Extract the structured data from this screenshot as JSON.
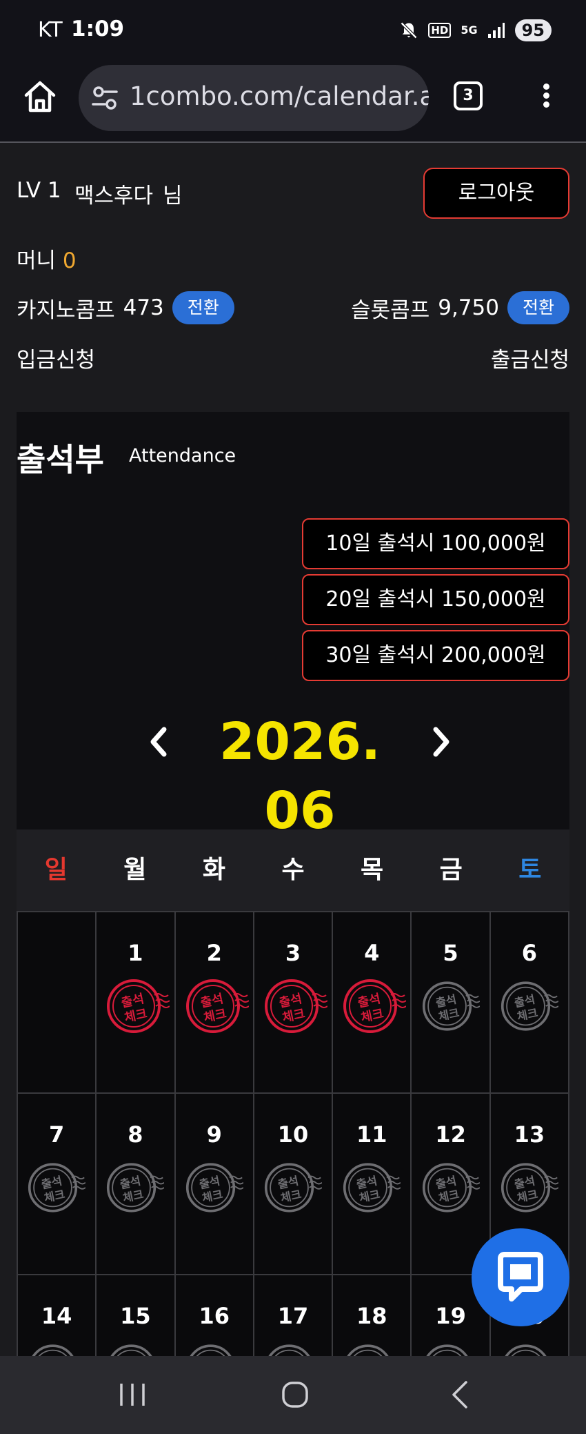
{
  "status_bar": {
    "carrier": "KT",
    "time": "1:09",
    "icons": [
      "mute-icon",
      "hd-icon",
      "5g-icon",
      "signal-icon"
    ],
    "hd_text": "HD",
    "network_text": "5G",
    "battery": "95"
  },
  "browser": {
    "url": "1combo.com/calendar.as",
    "tab_count": "3"
  },
  "account": {
    "level": "LV 1",
    "username": "맥스후다",
    "honorific": "님",
    "logout_label": "로그아웃",
    "money_label": "머니",
    "money_value": "0",
    "casino_comp_label": "카지노콤프",
    "casino_comp_value": "473",
    "slot_comp_label": "슬롯콤프",
    "slot_comp_value": "9,750",
    "convert_label": "전환",
    "deposit_label": "입금신청",
    "withdraw_label": "출금신청"
  },
  "attendance": {
    "title": "출석부",
    "subtitle": "Attendance",
    "rewards": [
      "10일 출석시 100,000원",
      "20일 출석시 150,000원",
      "30일 출석시 200,000원"
    ],
    "month": "2026. 06",
    "weekdays": [
      "일",
      "월",
      "화",
      "수",
      "목",
      "금",
      "토"
    ],
    "stamp_text_top": "출석",
    "stamp_text_bottom": "체크",
    "days": [
      {
        "day": "",
        "checked": false,
        "stamp": false
      },
      {
        "day": "1",
        "checked": true,
        "stamp": true
      },
      {
        "day": "2",
        "checked": true,
        "stamp": true
      },
      {
        "day": "3",
        "checked": true,
        "stamp": true
      },
      {
        "day": "4",
        "checked": true,
        "stamp": true
      },
      {
        "day": "5",
        "checked": false,
        "stamp": true
      },
      {
        "day": "6",
        "checked": false,
        "stamp": true
      },
      {
        "day": "7",
        "checked": false,
        "stamp": true
      },
      {
        "day": "8",
        "checked": false,
        "stamp": true
      },
      {
        "day": "9",
        "checked": false,
        "stamp": true
      },
      {
        "day": "10",
        "checked": false,
        "stamp": true
      },
      {
        "day": "11",
        "checked": false,
        "stamp": true
      },
      {
        "day": "12",
        "checked": false,
        "stamp": true
      },
      {
        "day": "13",
        "checked": false,
        "stamp": true
      },
      {
        "day": "14",
        "checked": false,
        "stamp": true
      },
      {
        "day": "15",
        "checked": false,
        "stamp": true
      },
      {
        "day": "16",
        "checked": false,
        "stamp": true
      },
      {
        "day": "17",
        "checked": false,
        "stamp": true
      },
      {
        "day": "18",
        "checked": false,
        "stamp": true
      },
      {
        "day": "19",
        "checked": false,
        "stamp": true
      },
      {
        "day": "20",
        "checked": false,
        "stamp": true
      }
    ]
  },
  "colors": {
    "accent_red": "#e53b33",
    "accent_blue": "#2b6fd6",
    "month_yellow": "#f5e400",
    "money_orange": "#f0a830",
    "stamp_checked": "#d81b3a",
    "stamp_unchecked": "#6e6e72"
  },
  "chat_button": "chat-icon",
  "nav_bar": [
    "recent-apps-icon",
    "home-icon",
    "back-icon"
  ]
}
